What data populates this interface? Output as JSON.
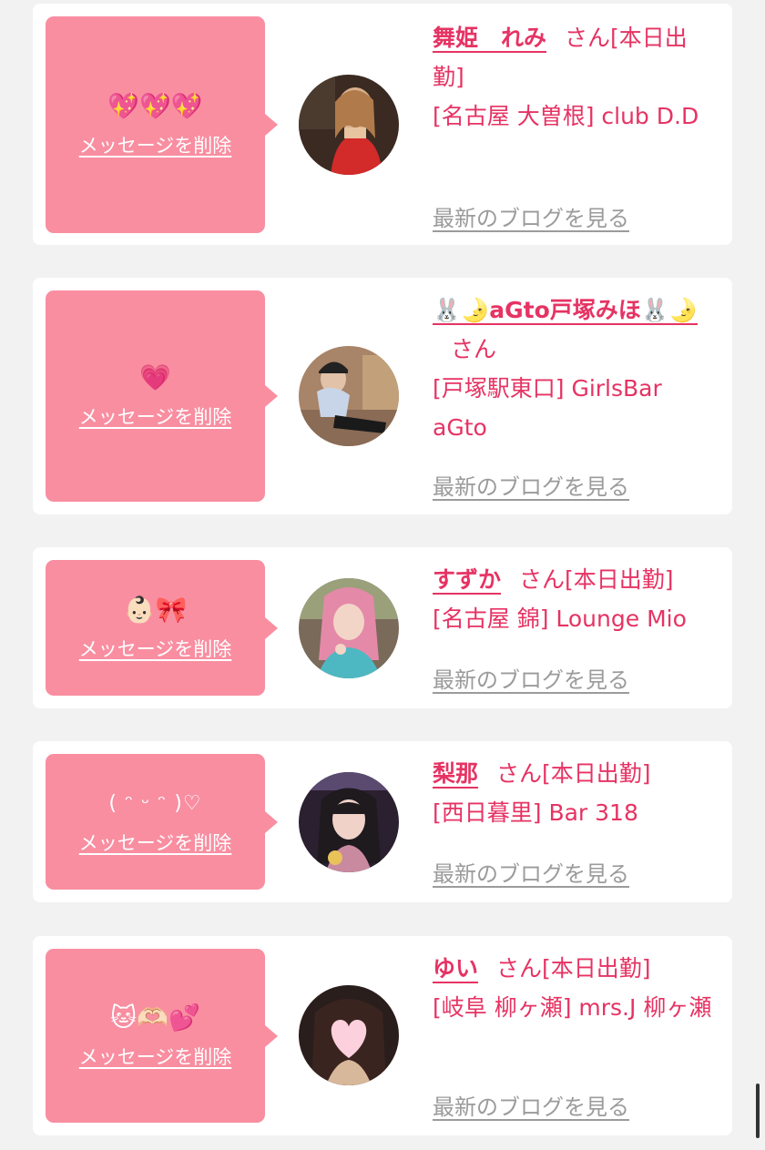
{
  "delete_label": "メッセージを削除",
  "blog_label": "最新のブログを見る",
  "entries": [
    {
      "message": "💖💖💖",
      "name": "舞姫　れみ",
      "honorific": "さん",
      "status": "[本日出勤]",
      "location": "[名古屋 大曽根] club D.D"
    },
    {
      "message": "💗",
      "name": "🐰🌛aGto戸塚みほ🐰🌛",
      "honorific": "さん",
      "status": "",
      "location": "[戸塚駅東口] GirlsBar aGto"
    },
    {
      "message": "👶🏻🎀",
      "name": "すずか",
      "honorific": "さん",
      "status": "[本日出勤]",
      "location": "[名古屋 錦] Lounge Mio"
    },
    {
      "message": "( ᵔ ᵕ ᵔ )♡",
      "name": "梨那",
      "honorific": "さん",
      "status": "[本日出勤]",
      "location": "[西日暮里] Bar 318"
    },
    {
      "message": "🐱🫶🏻💕",
      "name": "ゆい",
      "honorific": "さん",
      "status": "[本日出勤]",
      "location": "[岐阜 柳ヶ瀬] mrs.J 柳ヶ瀬"
    }
  ],
  "colors": {
    "accent": "#e63363",
    "message_box": "#f98ea1",
    "link_gray": "#9b9b9b",
    "background": "#f2f2f2"
  }
}
